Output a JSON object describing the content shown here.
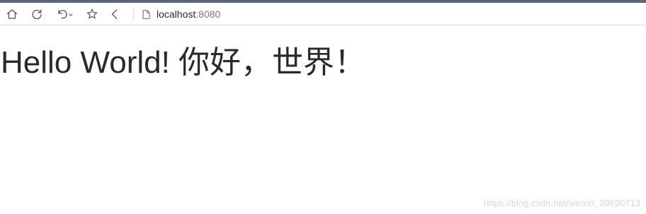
{
  "browser": {
    "toolbar_icons": [
      "home-icon",
      "refresh-icon",
      "undo-icon",
      "star-icon",
      "back-icon"
    ],
    "address": {
      "host": "localhost",
      "port": ":8080"
    }
  },
  "page": {
    "heading": "Hello World! 你好，世界！"
  },
  "watermark": "https://blog.csdn.net/weixin_39690713",
  "colors": {
    "top_strip": "#5f6673",
    "icon_stroke": "#555555",
    "text": "#2a2a2a",
    "watermark": "#d9d9d9"
  }
}
